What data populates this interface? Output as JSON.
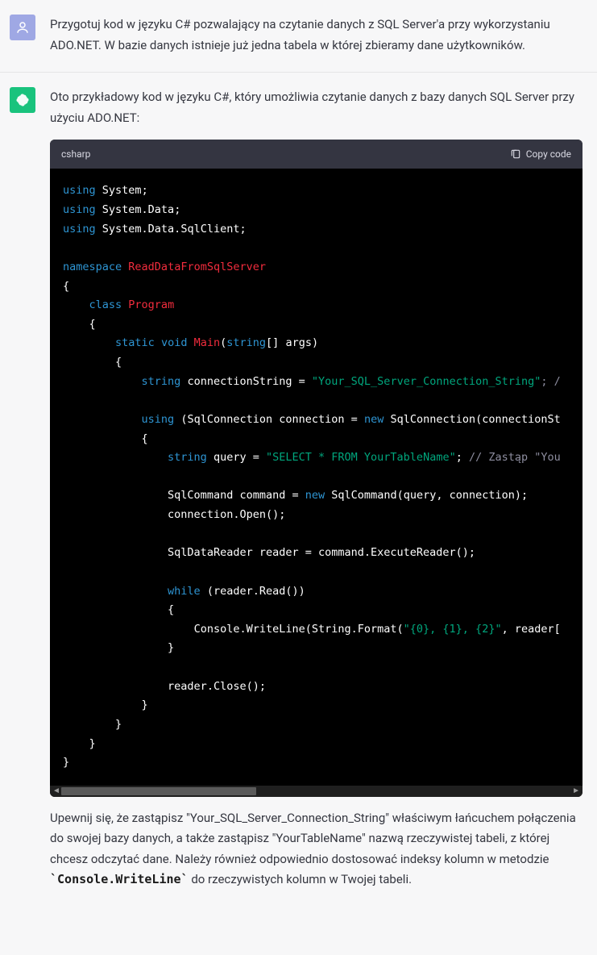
{
  "user_message": {
    "text": "Przygotuj kod w języku C# pozwalający na czytanie danych z SQL Server'a przy wykorzystaniu ADO.NET. W bazie danych istnieje już jedna tabela w której zbieramy dane użytkowników."
  },
  "assistant_message": {
    "intro": "Oto przykładowy kod w języku C#, który umożliwia czytanie danych z bazy danych SQL Server przy użyciu ADO.NET:",
    "code_lang": "csharp",
    "copy_label": "Copy code",
    "outro_before": "Upewnij się, że zastąpisz \"Your_SQL_Server_Connection_String\" właściwym łańcuchem połączenia do swojej bazy danych, a także zastąpisz \"YourTableName\" nazwą rzeczywistej tabeli, z której chcesz odczytać dane. Należy również odpowiednio dostosować indeksy kolumn w metodzie ",
    "outro_code": "`Console.WriteLine`",
    "outro_after": " do rzeczywistych kolumn w Twojej tabeli."
  },
  "code": {
    "tok": {
      "using": "using",
      "namespace": "namespace",
      "class": "class",
      "static": "static",
      "void": "void",
      "string": "string",
      "new": "new",
      "while": "while"
    },
    "ns": {
      "System": "System",
      "SystemData": "System.Data",
      "SystemDataSqlClient": "System.Data.SqlClient"
    },
    "names": {
      "nsName": "ReadDataFromSqlServer",
      "Program": "Program",
      "Main": "Main",
      "args": "args",
      "connectionString": "connectionString",
      "SqlConnection": "SqlConnection",
      "connection": "connection",
      "query": "query",
      "SqlCommand": "SqlCommand",
      "command": "command",
      "Open": "connection.Open();",
      "SqlDataReader": "SqlDataReader reader = command.ExecuteReader();",
      "readerRead": "(reader.Read())",
      "writeLinePrefix": "Console.WriteLine(String.Format(",
      "writeLineSuffix": ", reader[",
      "readerClose": "reader.Close();"
    },
    "strings": {
      "connStr": "\"Your_SQL_Server_Connection_String\"",
      "queryStr": "\"SELECT * FROM YourTableName\"",
      "formatStr": "\"{0}, {1}, {2}\""
    },
    "comments": {
      "c1": "; /",
      "c2": "// Zastąp \"You"
    },
    "braces": {
      "open": "{",
      "close": "}",
      "parenOpen": "(",
      "parenClose": ")",
      "bracket": "[] "
    }
  }
}
